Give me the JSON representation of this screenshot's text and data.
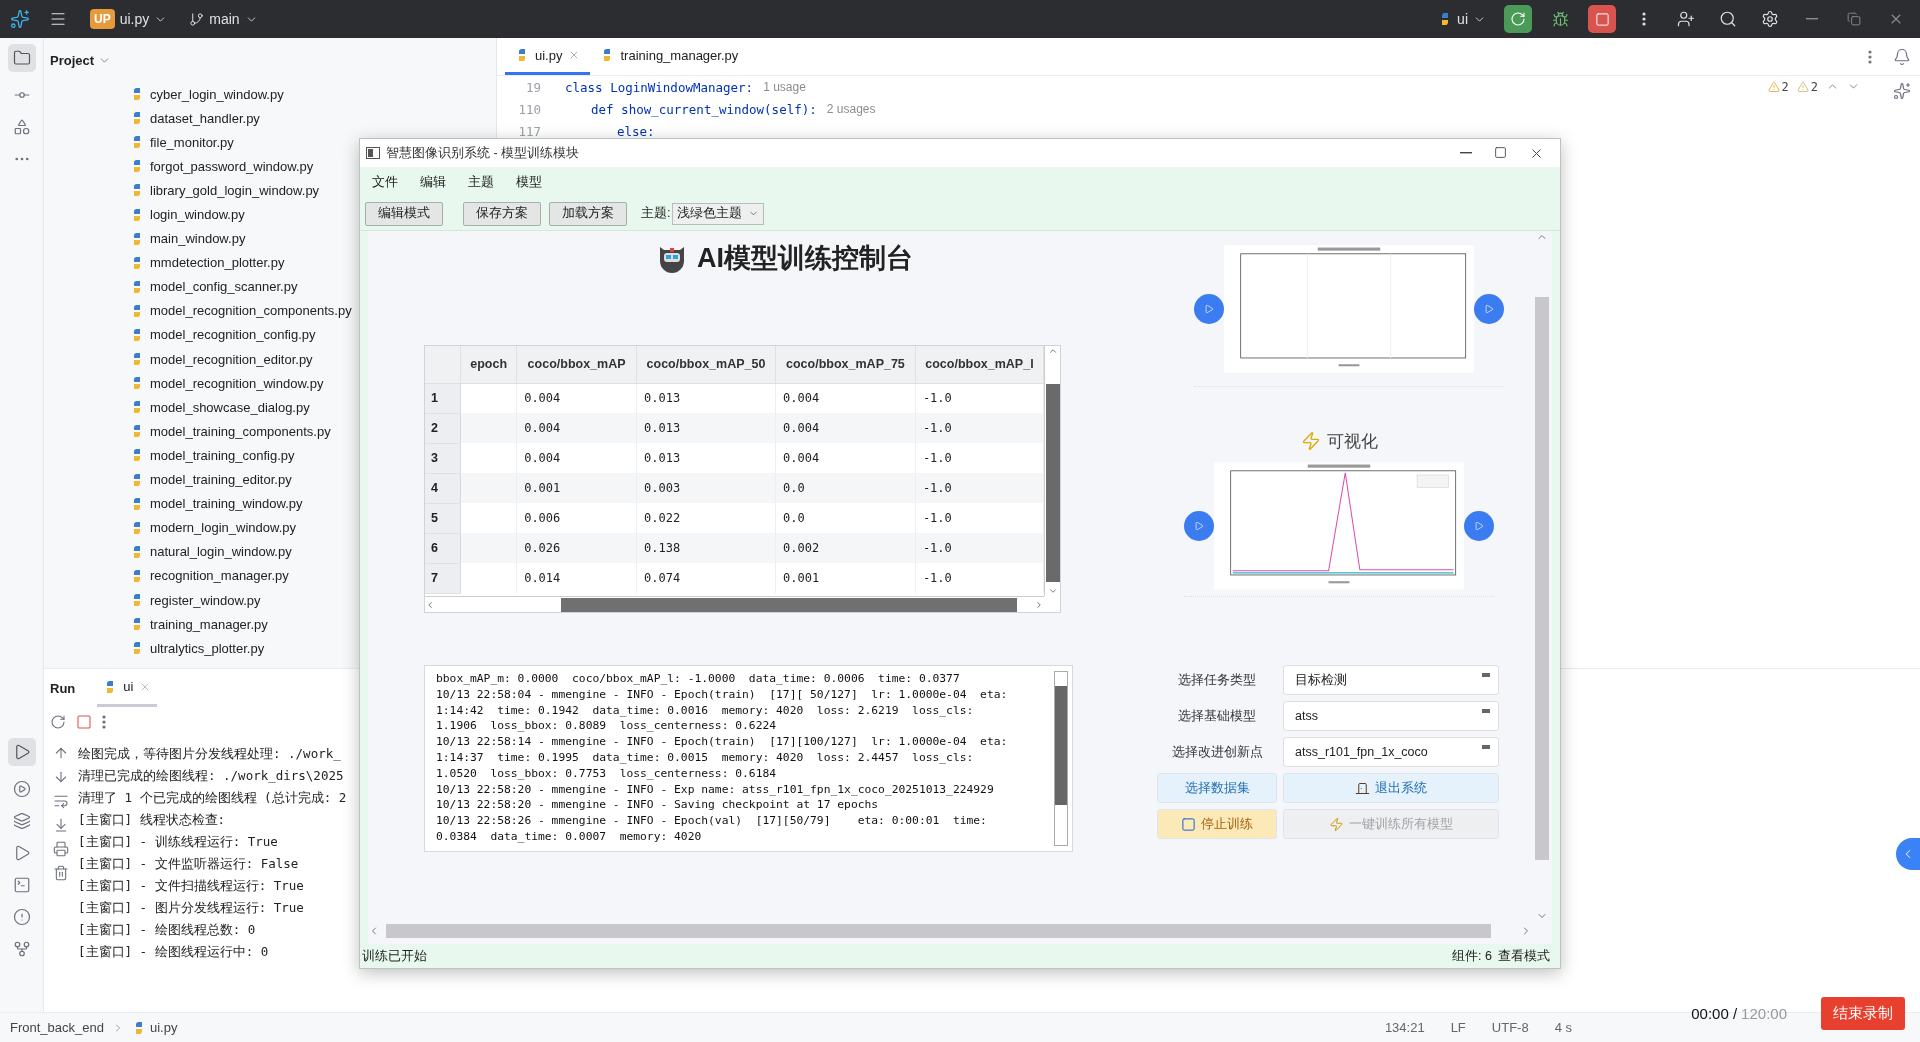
{
  "top_bar": {
    "project_badge": "UP",
    "project": "ui.py",
    "branch": "main",
    "run_config": "ui"
  },
  "project_panel": {
    "title": "Project",
    "files": [
      "cyber_login_window.py",
      "dataset_handler.py",
      "file_monitor.py",
      "forgot_password_window.py",
      "library_gold_login_window.py",
      "login_window.py",
      "main_window.py",
      "mmdetection_plotter.py",
      "model_config_scanner.py",
      "model_recognition_components.py",
      "model_recognition_config.py",
      "model_recognition_editor.py",
      "model_recognition_window.py",
      "model_showcase_dialog.py",
      "model_training_components.py",
      "model_training_config.py",
      "model_training_editor.py",
      "model_training_window.py",
      "modern_login_window.py",
      "natural_login_window.py",
      "recognition_manager.py",
      "register_window.py",
      "training_manager.py",
      "ultralytics_plotter.py"
    ]
  },
  "editor": {
    "tabs": [
      {
        "label": "ui.py",
        "selected": true
      },
      {
        "label": "training_manager.py",
        "selected": false
      }
    ],
    "inspections": [
      "2",
      "2"
    ],
    "lines": [
      {
        "number": "19",
        "code": "class LoginWindowManager:",
        "hint": "1 usage",
        "children": [
          {
            "number": "110",
            "code": "def show_current_window(self):",
            "hint": "2 usages",
            "children": [
              {
                "number": "117",
                "code": "else:"
              }
            ]
          }
        ]
      }
    ]
  },
  "run_panel": {
    "title": "Run",
    "tabs": [
      {
        "label": "ui",
        "selected": true
      }
    ],
    "console": [
      "绘图完成，等待图片分发线程处理: ./work_",
      "清理已完成的绘图线程: ./work_dirs\\2025",
      "清理了 1 个已完成的绘图线程 (总计完成: 2",
      "[主窗口] 线程状态检查:",
      "[主窗口] - 训练线程运行: True",
      "[主窗口] - 文件监听器运行: False",
      "[主窗口] - 文件扫描线程运行: True",
      "[主窗口] - 图片分发线程运行: True",
      "[主窗口] - 绘图线程总数: 0",
      "[主窗口] - 绘图线程运行中: 0"
    ]
  },
  "status_bar": {
    "breadcrumb": [
      "Front_back_end",
      "ui.py"
    ],
    "position": "134:21",
    "line_ending": "LF",
    "encoding": "UTF-8",
    "indent": "4 s"
  },
  "recorder": {
    "elapsed": "00:00 /",
    "total": "120:00",
    "stop_button": "结束录制"
  },
  "dialog": {
    "title": "智慧图像识别系统 - 模型训练模块",
    "menu": [
      "文件",
      "编辑",
      "主题",
      "模型"
    ],
    "toolbar": {
      "buttons": [
        "编辑模式",
        "保存方案",
        "加载方案"
      ],
      "theme_label": "主题:",
      "theme": "浅绿色主题"
    },
    "heading": "AI模型训练控制台",
    "table": {
      "columns": [
        "epoch",
        "coco/bbox_mAP",
        "coco/bbox_mAP_50",
        "coco/bbox_mAP_75",
        "coco/bbox_mAP_l"
      ],
      "rows": [
        {
          "index": "1",
          "values": [
            "0.004",
            "0.013",
            "0.004",
            "-1.0"
          ]
        },
        {
          "index": "2",
          "values": [
            "0.004",
            "0.013",
            "0.004",
            "-1.0"
          ]
        },
        {
          "index": "3",
          "values": [
            "0.004",
            "0.013",
            "0.004",
            "-1.0"
          ]
        },
        {
          "index": "4",
          "values": [
            "0.001",
            "0.003",
            "0.0",
            "-1.0"
          ]
        },
        {
          "index": "5",
          "values": [
            "0.006",
            "0.022",
            "0.0",
            "-1.0"
          ]
        },
        {
          "index": "6",
          "values": [
            "0.026",
            "0.138",
            "0.002",
            "-1.0"
          ]
        },
        {
          "index": "7",
          "values": [
            "0.014",
            "0.074",
            "0.001",
            "-1.0"
          ]
        }
      ]
    },
    "log": [
      "bbox_mAP_m: 0.0000  coco/bbox_mAP_l: -1.0000  data_time: 0.0006  time: 0.0377",
      "10/13 22:58:04 - mmengine - INFO - Epoch(train)  [17][ 50/127]  lr: 1.0000e-04  eta:",
      "1:14:42  time: 0.1942  data_time: 0.0016  memory: 4020  loss: 2.6219  loss_cls:",
      "1.1906  loss_bbox: 0.8089  loss_centerness: 0.6224",
      "10/13 22:58:14 - mmengine - INFO - Epoch(train)  [17][100/127]  lr: 1.0000e-04  eta:",
      "1:14:37  time: 0.1995  data_time: 0.0015  memory: 4020  loss: 2.4457  loss_cls:",
      "1.0520  loss_bbox: 0.7753  loss_centerness: 0.6184",
      "10/13 22:58:20 - mmengine - INFO - Exp name: atss_r101_fpn_1x_coco_20251013_224929",
      "10/13 22:58:20 - mmengine - INFO - Saving checkpoint at 17 epochs",
      "10/13 22:58:26 - mmengine - INFO - Epoch(val)  [17][50/79]    eta: 0:00:01  time:",
      "0.0384  data_time: 0.0007  memory: 4020"
    ],
    "visualization_title": "可视化",
    "form": [
      {
        "label": "选择任务类型",
        "value": "目标检测"
      },
      {
        "label": "选择基础模型",
        "value": "atss"
      },
      {
        "label": "选择改进创新点",
        "value": "atss_r101_fpn_1x_coco"
      }
    ],
    "actions": [
      {
        "label": "选择数据集",
        "kind": "dataset",
        "disabled": false
      },
      {
        "label": "退出系统",
        "kind": "exit",
        "disabled": false
      },
      {
        "label": "停止训练",
        "kind": "stop",
        "disabled": false
      },
      {
        "label": "一键训练所有模型",
        "kind": "batch",
        "disabled": true
      }
    ],
    "status": {
      "message": "训练已开始",
      "components": "组件: 6",
      "mode": "查看模式"
    }
  }
}
